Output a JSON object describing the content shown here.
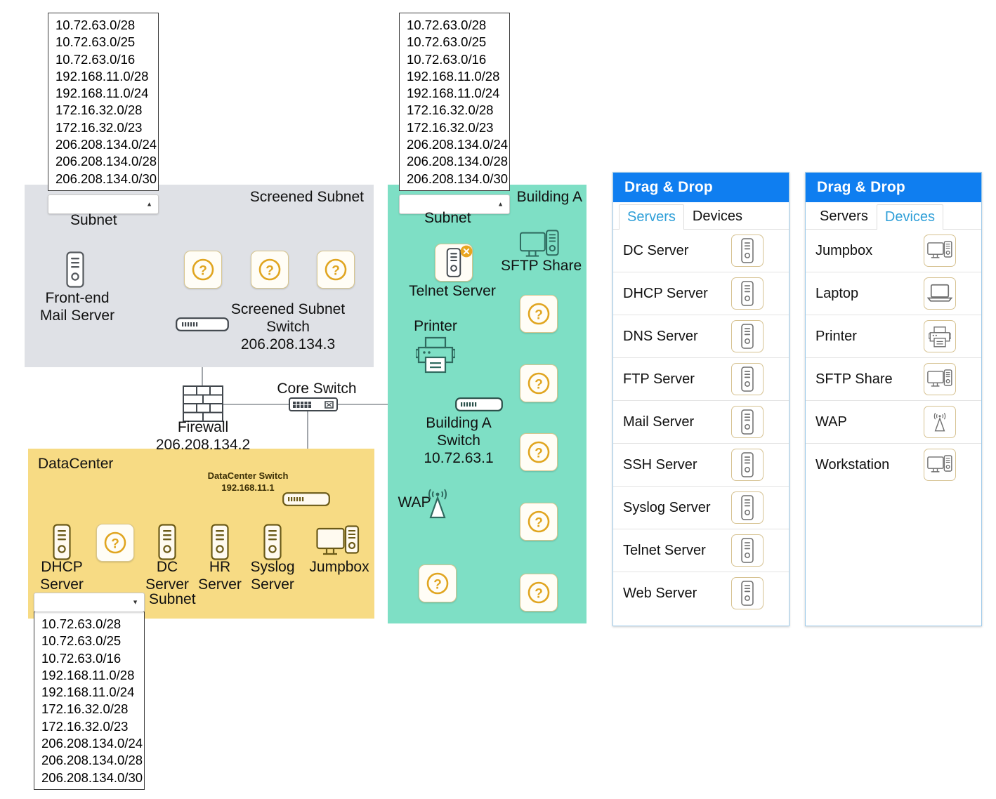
{
  "subnet_options": [
    "10.72.63.0/28",
    "10.72.63.0/25",
    "10.72.63.0/16",
    "192.168.11.0/28",
    "192.168.11.0/24",
    "172.16.32.0/28",
    "172.16.32.0/23",
    "206.208.134.0/24",
    "206.208.134.0/28",
    "206.208.134.0/30"
  ],
  "diagram": {
    "screened_subnet": {
      "title": "Screened Subnet",
      "subnet_label": "Subnet",
      "subnet_value": "",
      "nodes": {
        "mail_server": "Front-end\nMail Server",
        "mail_server_line1": "Front-end",
        "mail_server_line2": "Mail Server",
        "switch_line1": "Screened Subnet",
        "switch_line2": "Switch",
        "switch_ip": "206.208.134.3"
      }
    },
    "core": {
      "firewall_label": "Firewall",
      "firewall_ip": "206.208.134.2",
      "core_switch_label": "Core Switch"
    },
    "datacenter": {
      "title": "DataCenter",
      "switch_label": "DataCenter Switch",
      "switch_ip": "192.168.11.1",
      "subnet_label": "Subnet",
      "subnet_value": "",
      "nodes": [
        {
          "l1": "DHCP",
          "l2": "Server"
        },
        {
          "l1": "DC",
          "l2": "Server"
        },
        {
          "l1": "HR",
          "l2": "Server"
        },
        {
          "l1": "Syslog",
          "l2": "Server"
        },
        {
          "l1": "Jumpbox",
          "l2": ""
        }
      ]
    },
    "building_a": {
      "title": "Building A",
      "subnet_label": "Subnet",
      "subnet_value": "",
      "nodes": {
        "telnet_server": "Telnet Server",
        "sftp_share": "SFTP Share",
        "printer": "Printer",
        "wap": "WAP",
        "switch_line1": "Building A",
        "switch_line2": "Switch",
        "switch_ip": "10.72.63.1"
      }
    }
  },
  "panels": [
    {
      "header": "Drag & Drop",
      "tabs": [
        {
          "label": "Servers",
          "active": true
        },
        {
          "label": "Devices",
          "active": false
        }
      ],
      "items": [
        {
          "label": "DC Server",
          "icon": "server-icon"
        },
        {
          "label": "DHCP Server",
          "icon": "server-icon"
        },
        {
          "label": "DNS Server",
          "icon": "server-icon"
        },
        {
          "label": "FTP Server",
          "icon": "server-icon"
        },
        {
          "label": "Mail Server",
          "icon": "server-icon"
        },
        {
          "label": "SSH Server",
          "icon": "server-icon"
        },
        {
          "label": "Syslog Server",
          "icon": "server-icon"
        },
        {
          "label": "Telnet Server",
          "icon": "server-icon"
        },
        {
          "label": "Web Server",
          "icon": "server-icon"
        }
      ]
    },
    {
      "header": "Drag & Drop",
      "tabs": [
        {
          "label": "Servers",
          "active": false
        },
        {
          "label": "Devices",
          "active": true
        }
      ],
      "items": [
        {
          "label": "Jumpbox",
          "icon": "workstation-icon"
        },
        {
          "label": "Laptop",
          "icon": "laptop-icon"
        },
        {
          "label": "Printer",
          "icon": "printer-icon"
        },
        {
          "label": "SFTP Share",
          "icon": "workstation-icon"
        },
        {
          "label": "WAP",
          "icon": "wap-icon"
        },
        {
          "label": "Workstation",
          "icon": "workstation-icon"
        }
      ]
    }
  ],
  "colors": {
    "screened_subnet_bg": "#dfe1e6",
    "datacenter_bg": "#f7db84",
    "building_a_bg": "#7edfc5",
    "panel_header_bg": "#0f7ef0",
    "active_tab_text": "#2f9fd8",
    "unknown_icon": "#e0a520",
    "wire": "#7a7f85"
  }
}
